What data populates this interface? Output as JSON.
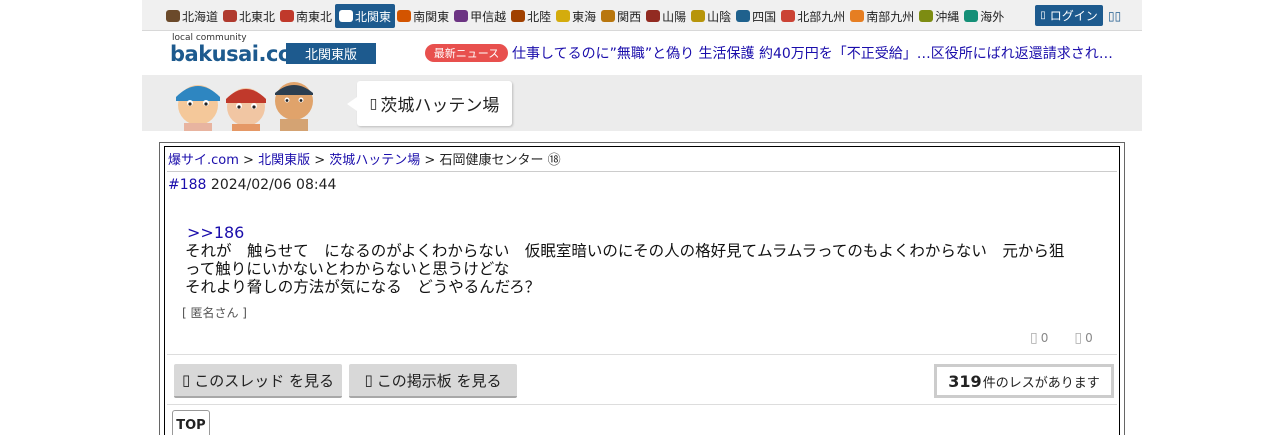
{
  "regions": [
    {
      "label": "北海道",
      "icon": "hokkaido-icon",
      "color": "#6b4a2b"
    },
    {
      "label": "北東北",
      "icon": "tohoku-north-icon",
      "color": "#b03a2e"
    },
    {
      "label": "南東北",
      "icon": "tohoku-south-icon",
      "color": "#c0392b"
    },
    {
      "label": "北関東",
      "icon": "kanto-north-icon",
      "color": "#e8504e",
      "active": true
    },
    {
      "label": "南関東",
      "icon": "kanto-south-icon",
      "color": "#d35400"
    },
    {
      "label": "甲信越",
      "icon": "koshinetsu-icon",
      "color": "#6c3483"
    },
    {
      "label": "北陸",
      "icon": "hokuriku-icon",
      "color": "#a04000"
    },
    {
      "label": "東海",
      "icon": "tokai-icon",
      "color": "#d4ac0d"
    },
    {
      "label": "関西",
      "icon": "kansai-icon",
      "color": "#b9770e"
    },
    {
      "label": "山陽",
      "icon": "sanyo-icon",
      "color": "#922b21"
    },
    {
      "label": "山陰",
      "icon": "sanin-icon",
      "color": "#b7950b"
    },
    {
      "label": "四国",
      "icon": "shikoku-icon",
      "color": "#1f618d"
    },
    {
      "label": "北部九州",
      "icon": "kyushu-north-icon",
      "color": "#cb4335"
    },
    {
      "label": "南部九州",
      "icon": "kyushu-south-icon",
      "color": "#e67e22"
    },
    {
      "label": "沖縄",
      "icon": "okinawa-icon",
      "color": "#7d8c12"
    },
    {
      "label": "海外",
      "icon": "overseas-icon",
      "color": "#148f77"
    }
  ],
  "login_label": "ログイン",
  "header": {
    "logo_small": "local community",
    "logo_main": "bakusai",
    "logo_dot": ".",
    "logo_tld": "com",
    "edition": "北関東版",
    "news_badge": "最新ニュース",
    "news_text": "仕事してるのに”無職”と偽り 生活保護 約40万円を「不正受給」…区役所にばれ返還請求される..."
  },
  "banner": {
    "board_title": "茨城ハッテン場"
  },
  "breadcrumb": {
    "home": "爆サイ.com",
    "edition": "北関東版",
    "board": "茨城ハッテン場",
    "sep": " > ",
    "thread": "石岡健康センター ⑱"
  },
  "post": {
    "number": "#188",
    "datetime": "2024/02/06 08:44",
    "reply_to": ">>186",
    "body_line1": "それが　触らせて　になるのがよくわからない　仮眠室暗いのにその人の格好見てムラムラってのもよくわからない　元から狙",
    "body_line2": "って触りにいかないとわからないと思うけどな",
    "body_line3": "それより脅しの方法が気になる　どうやるんだろ？",
    "author": "[ 匿名さん ]",
    "likes": "0",
    "dislikes": "0"
  },
  "actions": {
    "view_thread": "このスレッド を見る",
    "view_board": "この掲示板 を見る",
    "res_count": "319",
    "res_suffix": "件のレスがあります",
    "top": "TOP"
  },
  "colors": {
    "brand": "#1d5a8e",
    "link": "#1a0dab",
    "news_badge": "#e8504e"
  }
}
